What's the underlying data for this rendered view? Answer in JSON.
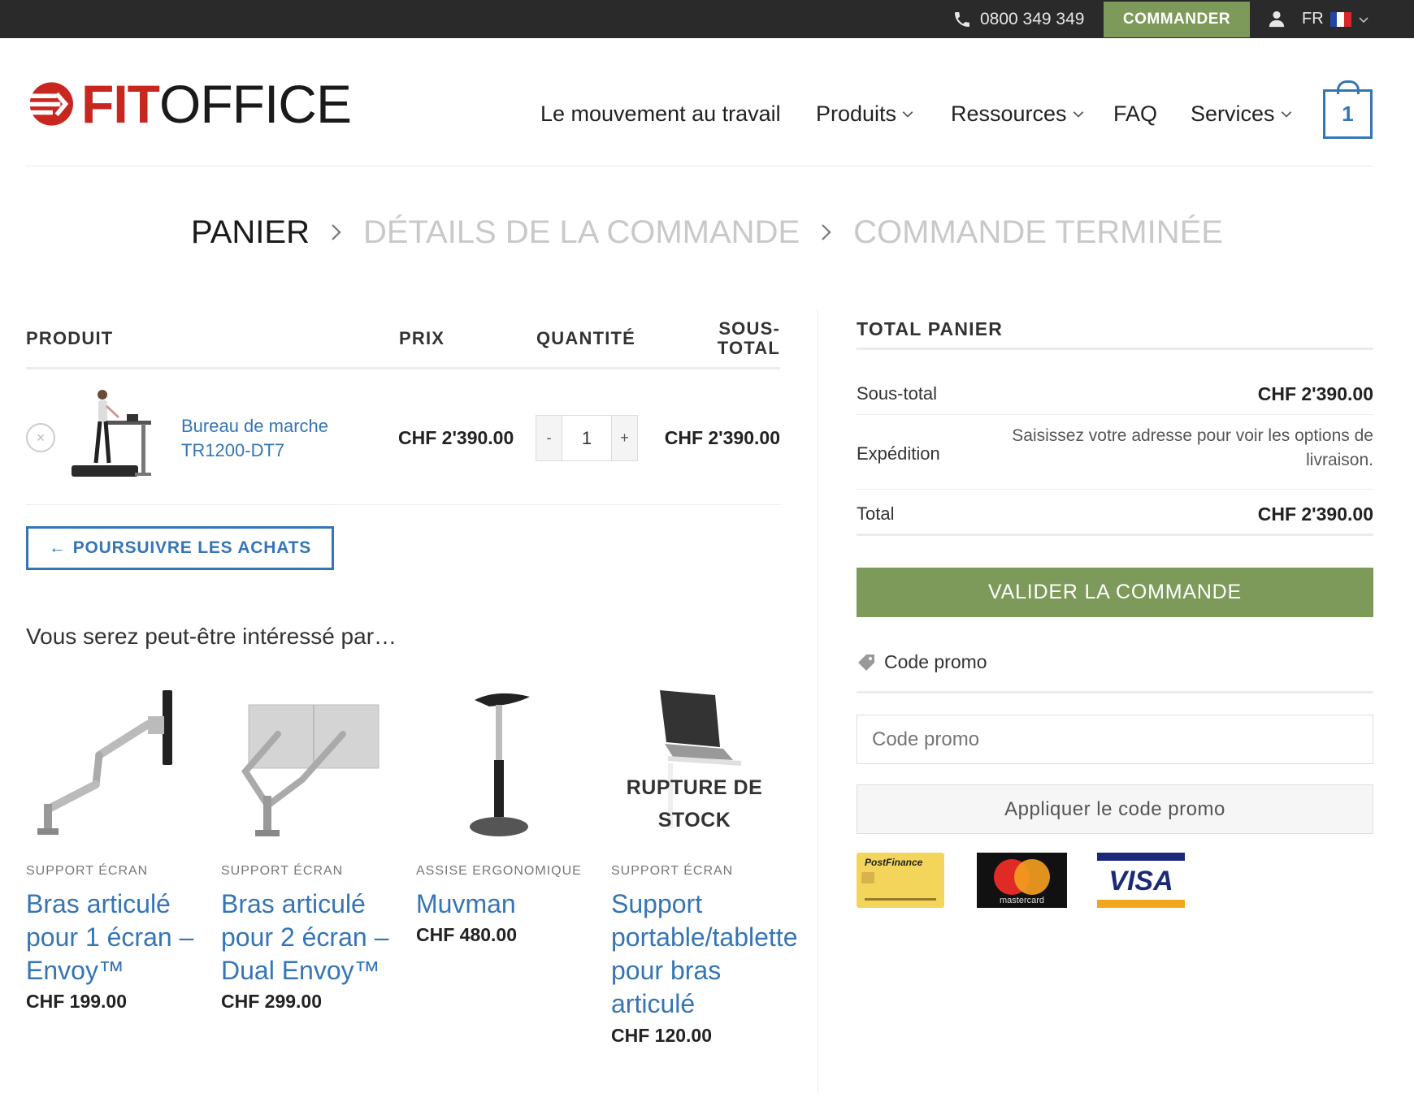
{
  "topbar": {
    "phone": "0800 349 349",
    "order_button": "COMMANDER",
    "language": "FR"
  },
  "brand": {
    "fit": "FIT",
    "office": "OFFICE",
    "colors": {
      "red": "#c8261e",
      "blue": "#3575b5",
      "green": "#7d9a5b"
    }
  },
  "nav": {
    "items": [
      {
        "label": "Le mouvement au travail",
        "has_dropdown": false
      },
      {
        "label": "Produits",
        "has_dropdown": true
      },
      {
        "label": "Ressources",
        "has_dropdown": true
      },
      {
        "label": "FAQ",
        "has_dropdown": false
      },
      {
        "label": "Services",
        "has_dropdown": true
      }
    ],
    "cart_count": "1"
  },
  "breadcrumb": {
    "steps": [
      "PANIER",
      "DÉTAILS DE LA COMMANDE",
      "COMMANDE TERMINÉE"
    ],
    "active_index": 0
  },
  "cart": {
    "columns": {
      "product": "PRODUIT",
      "price": "PRIX",
      "quantity": "QUANTITÉ",
      "subtotal_line1": "SOUS-",
      "subtotal_line2": "TOTAL"
    },
    "items": [
      {
        "name_line1": "Bureau de marche",
        "name_line2": "TR1200-DT7",
        "price": "CHF 2'390.00",
        "quantity": "1",
        "subtotal": "CHF 2'390.00"
      }
    ],
    "qty_minus": "-",
    "qty_plus": "+",
    "remove_symbol": "×",
    "continue_arrow": "←",
    "continue_label": "POURSUIVRE LES ACHATS"
  },
  "related": {
    "heading": "Vous serez peut-être intéressé par…",
    "products": [
      {
        "category": "SUPPORT ÉCRAN",
        "title_lines": [
          "Bras articulé",
          "pour 1 écran –",
          "Envoy™"
        ],
        "price": "CHF 199.00"
      },
      {
        "category": "SUPPORT ÉCRAN",
        "title_lines": [
          "Bras articulé",
          "pour 2 écran –",
          "Dual Envoy™"
        ],
        "price": "CHF 299.00"
      },
      {
        "category": "ASSISE ERGONOMIQUE",
        "title_lines": [
          "Muvman"
        ],
        "price": "CHF 480.00"
      },
      {
        "category": "SUPPORT ÉCRAN",
        "title_lines": [
          "Support",
          "portable/tablette",
          "pour bras",
          "articulé"
        ],
        "price": "CHF 120.00",
        "badge_line1": "RUPTURE DE",
        "badge_line2": "STOCK"
      }
    ]
  },
  "totals": {
    "title": "TOTAL PANIER",
    "subtotal_label": "Sous-total",
    "subtotal_value": "CHF 2'390.00",
    "shipping_label": "Expédition",
    "shipping_note": "Saisissez votre adresse pour voir les options de livraison.",
    "total_label": "Total",
    "total_value": "CHF 2'390.00",
    "checkout_button": "VALIDER LA COMMANDE",
    "promo_label": "Code promo",
    "promo_placeholder": "Code promo",
    "apply_button": "Appliquer le code promo"
  },
  "payments": {
    "postfinance": "PostFinance",
    "mastercard": "mastercard",
    "visa": "VISA"
  }
}
